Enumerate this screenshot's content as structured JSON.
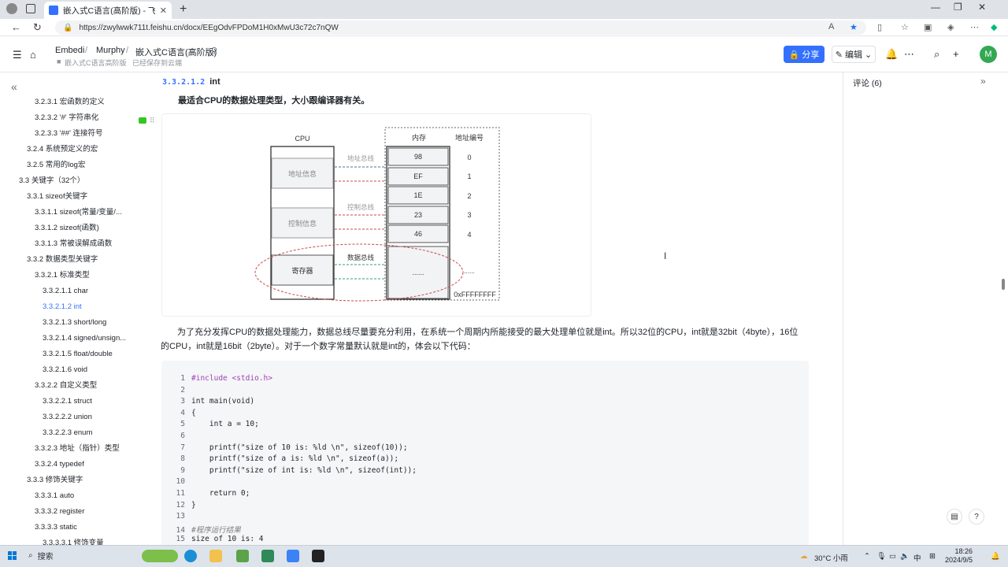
{
  "browser": {
    "tab_title": "嵌入式C语言(高阶版) - 飞书云文档",
    "url": "https://zwylwwk711t.feishu.cn/docx/EEgOdvFPDoM1H0xMwU3c72c7nQW"
  },
  "header": {
    "crumbs": [
      "Embedi",
      "Murphy",
      "嵌入式C语言(高阶版)"
    ],
    "sub_crumb": "嵌入式C语言高阶版",
    "save_status": "已经保存到云端",
    "share_label": "分享",
    "edit_label": "编辑",
    "avatar_letter": "M"
  },
  "toc": [
    {
      "label": "3.2.3.1 宏函数的定义",
      "level": 2
    },
    {
      "label": "3.2.3.2 '#' 字符串化",
      "level": 2
    },
    {
      "label": "3.2.3.3 '##' 连接符号",
      "level": 2
    },
    {
      "label": "3.2.4 系统预定义的宏",
      "level": 1
    },
    {
      "label": "3.2.5 常用的log宏",
      "level": 1
    },
    {
      "label": "3.3 关键字（32个）",
      "level": 0
    },
    {
      "label": "3.3.1 sizeof关键字",
      "level": 1
    },
    {
      "label": "3.3.1.1 sizeof(常量/变量/...",
      "level": 2
    },
    {
      "label": "3.3.1.2 sizeof(函数)",
      "level": 2
    },
    {
      "label": "3.3.1.3 常被误解成函数",
      "level": 2
    },
    {
      "label": "3.3.2 数据类型关键字",
      "level": 1
    },
    {
      "label": "3.3.2.1 标准类型",
      "level": 2
    },
    {
      "label": "3.3.2.1.1 char",
      "level": 3
    },
    {
      "label": "3.3.2.1.2 int",
      "level": 3,
      "active": true
    },
    {
      "label": "3.3.2.1.3 short/long",
      "level": 3
    },
    {
      "label": "3.3.2.1.4 signed/unsign...",
      "level": 3
    },
    {
      "label": "3.3.2.1.5 float/double",
      "level": 3
    },
    {
      "label": "3.3.2.1.6 void",
      "level": 3
    },
    {
      "label": "3.3.2.2 自定义类型",
      "level": 2
    },
    {
      "label": "3.3.2.2.1 struct",
      "level": 3
    },
    {
      "label": "3.3.2.2.2 union",
      "level": 3
    },
    {
      "label": "3.3.2.2.3 enum",
      "level": 3
    },
    {
      "label": "3.3.2.3 地址（指针）类型",
      "level": 2
    },
    {
      "label": "3.3.2.4 typedef",
      "level": 2
    },
    {
      "label": "3.3.3 修饰关键字",
      "level": 1
    },
    {
      "label": "3.3.3.1 auto",
      "level": 2
    },
    {
      "label": "3.3.3.2 register",
      "level": 2
    },
    {
      "label": "3.3.3.3 static",
      "level": 2
    },
    {
      "label": "3.3.3.3.1 修饰变量",
      "level": 3
    }
  ],
  "content": {
    "heading_num": "3.3.2.1.2",
    "heading_text": "int",
    "lead": "最适合CPU的数据处理类型，大小跟编译器有关。",
    "paragraph": "为了充分发挥CPU的数据处理能力，数据总线尽量要充分利用，在系统一个周期内所能接受的最大处理单位就是int。所以32位的CPU，int就是32bit（4byte），16位的CPU，int就是16bit（2byte）。对于一个数字常量默认就是int的，体会以下代码："
  },
  "diagram": {
    "cpu_label": "CPU",
    "cpu_blocks": [
      "地址信息",
      "控制信息",
      "寄存器"
    ],
    "bus_labels": [
      "地址总线",
      "控制总线",
      "数据总线"
    ],
    "mem_label": "内存",
    "addr_label": "地址编号",
    "mem_cells": [
      "98",
      "EF",
      "1E",
      "23",
      "46",
      "......"
    ],
    "addrs": [
      "0",
      "1",
      "2",
      "3",
      "4",
      "0xFFFFFFFF"
    ],
    "dots": "......"
  },
  "code": [
    {
      "n": "1",
      "t": "#include <stdio.h>"
    },
    {
      "n": "2",
      "t": ""
    },
    {
      "n": "3",
      "t": "int main(void)"
    },
    {
      "n": "4",
      "t": "{"
    },
    {
      "n": "5",
      "t": "    int a = 10;"
    },
    {
      "n": "6",
      "t": ""
    },
    {
      "n": "7",
      "t": "    printf(\"size of 10 is: %ld \\n\", sizeof(10));"
    },
    {
      "n": "8",
      "t": "    printf(\"size of a is: %ld \\n\", sizeof(a));"
    },
    {
      "n": "9",
      "t": "    printf(\"size of int is: %ld \\n\", sizeof(int));"
    },
    {
      "n": "10",
      "t": ""
    },
    {
      "n": "11",
      "t": "    return 0;"
    },
    {
      "n": "12",
      "t": "}"
    },
    {
      "n": "13",
      "t": ""
    },
    {
      "n": "14",
      "t": "#程序运行结果"
    },
    {
      "n": "15",
      "t": "size of 10 is: 4"
    }
  ],
  "comments": {
    "title": "评论 (6)"
  },
  "taskbar": {
    "search": "搜索",
    "weather": "30°C 小雨",
    "ime": "中",
    "time": "18:26",
    "date": "2024/9/5"
  }
}
